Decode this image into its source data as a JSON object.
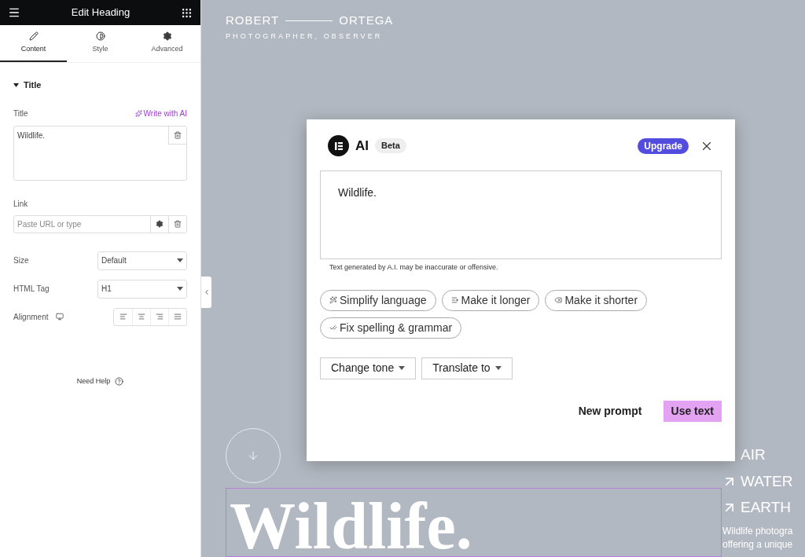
{
  "editor": {
    "title": "Edit Heading",
    "tabs": [
      {
        "label": "Content",
        "selected": true
      },
      {
        "label": "Style",
        "selected": false
      },
      {
        "label": "Advanced",
        "selected": false
      }
    ],
    "section": {
      "title": "Title",
      "expanded": true
    },
    "title_field": {
      "label": "Title",
      "ai_link": "Write with AI",
      "value": "Wildlife."
    },
    "link_field": {
      "label": "Link",
      "placeholder": "Paste URL or type"
    },
    "size": {
      "label": "Size",
      "value": "Default"
    },
    "html_tag": {
      "label": "HTML Tag",
      "value": "H1"
    },
    "alignment": {
      "label": "Alignment"
    },
    "help": "Need Help"
  },
  "preview": {
    "brand_first": "ROBERT",
    "brand_last": "ORTEGA",
    "tagline": "PHOTOGRAPHER, OBSERVER",
    "heading": "Wildlife.",
    "elements": [
      {
        "label": "AIR"
      },
      {
        "label": "WATER"
      },
      {
        "label": "EARTH"
      }
    ],
    "intro_lines": [
      "Wildlife photogra",
      "offering a unique"
    ]
  },
  "ai_dialog": {
    "title": "AI",
    "badge": "Beta",
    "upgrade": "Upgrade",
    "result": "Wildlife.",
    "disclaimer": "Text generated by A.I. may be inaccurate or offensive.",
    "actions": [
      {
        "label": "Simplify language",
        "kind": "simplify"
      },
      {
        "label": "Make it longer",
        "kind": "longer"
      },
      {
        "label": "Make it shorter",
        "kind": "shorter"
      },
      {
        "label": "Fix spelling & grammar",
        "kind": "fix"
      }
    ],
    "dropdowns": [
      "Change tone",
      "Translate to"
    ],
    "buttons": [
      {
        "label": "New prompt",
        "kind": "text"
      },
      {
        "label": "Use text",
        "kind": "primary"
      }
    ]
  }
}
